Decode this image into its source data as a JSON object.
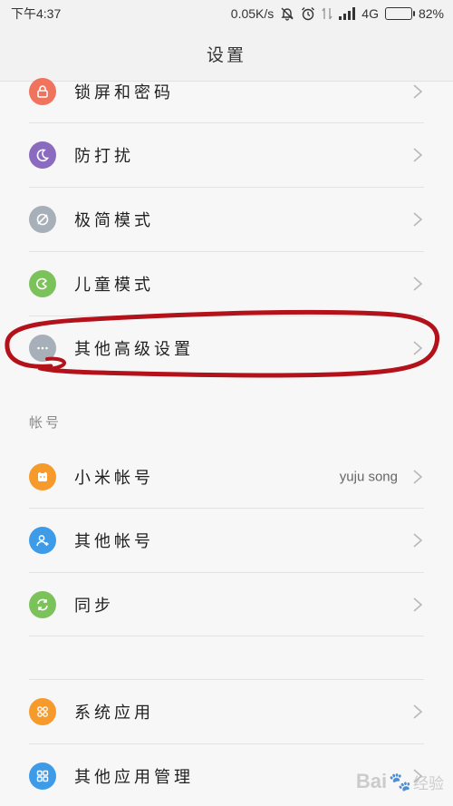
{
  "status_bar": {
    "time": "下午4:37",
    "speed": "0.05K/s",
    "network": "4G",
    "battery": "82%",
    "battery_level": 0.82
  },
  "header": {
    "title": "设置"
  },
  "items_top": [
    {
      "label": "锁屏和密码",
      "icon": "lock-icon",
      "color": "#f0735e"
    },
    {
      "label": "防打扰",
      "icon": "moon-icon",
      "color": "#8a6bbf"
    },
    {
      "label": "极简模式",
      "icon": "simple-mode-icon",
      "color": "#a7afb8"
    },
    {
      "label": "儿童模式",
      "icon": "child-mode-icon",
      "color": "#7cc25b"
    },
    {
      "label": "其他高级设置",
      "icon": "more-icon",
      "color": "#a7afb8"
    }
  ],
  "accounts_section": {
    "title": "帐号",
    "items": [
      {
        "label": "小米帐号",
        "value": "yuju song",
        "icon": "mi-account-icon",
        "color": "#f59a2b"
      },
      {
        "label": "其他帐号",
        "icon": "add-account-icon",
        "color": "#3e9be8"
      },
      {
        "label": "同步",
        "icon": "sync-icon",
        "color": "#7cc25b"
      }
    ]
  },
  "apps_section": {
    "items": [
      {
        "label": "系统应用",
        "icon": "system-apps-icon",
        "color": "#f59a2b"
      },
      {
        "label": "其他应用管理",
        "icon": "app-manager-icon",
        "color": "#3e9be8"
      }
    ]
  },
  "annotation": {
    "color": "#b3121a"
  },
  "watermark": {
    "text": "Bai",
    "suffix": "经验"
  }
}
